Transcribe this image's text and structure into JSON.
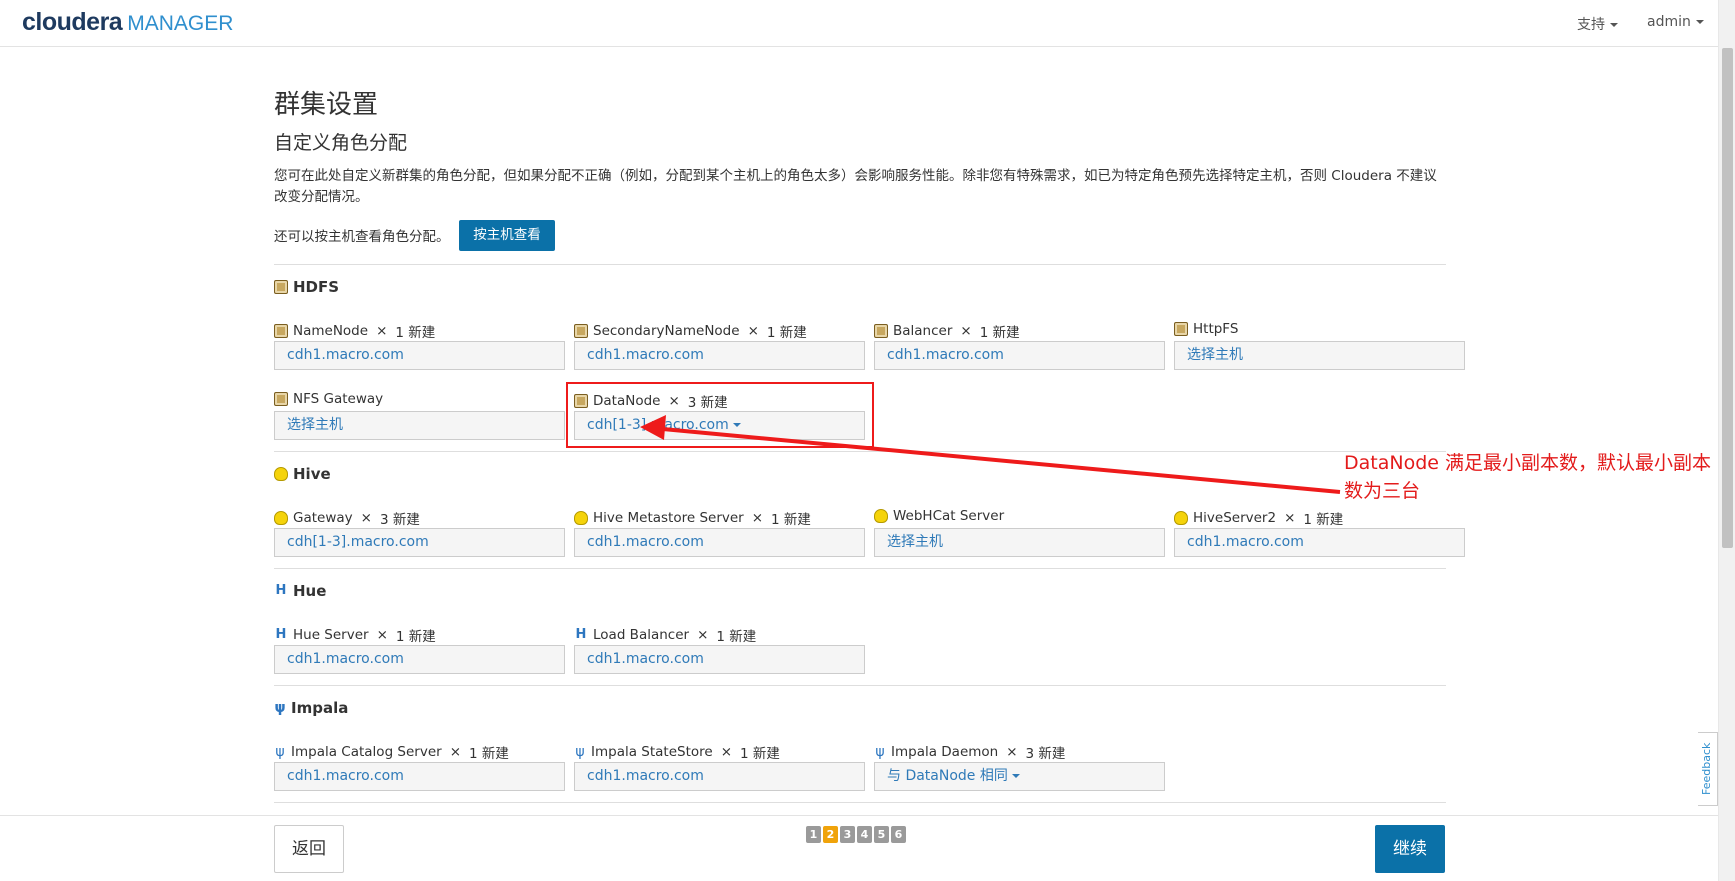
{
  "app": {
    "brand": "cloudera",
    "product": "MANAGER"
  },
  "topnav": {
    "support": "支持",
    "user": "admin"
  },
  "page": {
    "title": "群集设置",
    "subtitle": "自定义角色分配",
    "description": "您可在此处自定义新群集的角色分配，但如果分配不正确（例如，分配到某个主机上的角色太多）会影响服务性能。除非您有特殊需求，如已为特定角色预先选择特定主机，否则 Cloudera 不建议改变分配情况。",
    "byhost_text": "还可以按主机查看角色分配。",
    "byhost_button": "按主机查看"
  },
  "services": [
    {
      "name": "HDFS",
      "icon": "hdfs-icon",
      "roles": [
        {
          "name": "NameNode",
          "x": "×",
          "count": "1 新建",
          "value": "cdh1.macro.com"
        },
        {
          "name": "SecondaryNameNode",
          "x": "×",
          "count": "1 新建",
          "value": "cdh1.macro.com"
        },
        {
          "name": "Balancer",
          "x": "×",
          "count": "1 新建",
          "value": "cdh1.macro.com"
        },
        {
          "name": "HttpFS",
          "x": "",
          "count": "",
          "value": "选择主机"
        },
        {
          "name": "NFS Gateway",
          "x": "",
          "count": "",
          "value": "选择主机"
        },
        {
          "name": "DataNode",
          "x": "×",
          "count": "3 新建",
          "value": "cdh[1-3].macro.com"
        }
      ]
    },
    {
      "name": "Hive",
      "icon": "hive-icon",
      "roles": [
        {
          "name": "Gateway",
          "x": "×",
          "count": "3 新建",
          "value": "cdh[1-3].macro.com"
        },
        {
          "name": "Hive Metastore Server",
          "x": "×",
          "count": "1 新建",
          "value": "cdh1.macro.com"
        },
        {
          "name": "WebHCat Server",
          "x": "",
          "count": "",
          "value": "选择主机"
        },
        {
          "name": "HiveServer2",
          "x": "×",
          "count": "1 新建",
          "value": "cdh1.macro.com"
        }
      ]
    },
    {
      "name": "Hue",
      "icon": "hue-icon",
      "roles": [
        {
          "name": "Hue Server",
          "x": "×",
          "count": "1 新建",
          "value": "cdh1.macro.com"
        },
        {
          "name": "Load Balancer",
          "x": "×",
          "count": "1 新建",
          "value": "cdh1.macro.com"
        }
      ]
    },
    {
      "name": "Impala",
      "icon": "impala-icon",
      "roles": [
        {
          "name": "Impala Catalog Server",
          "x": "×",
          "count": "1 新建",
          "value": "cdh1.macro.com"
        },
        {
          "name": "Impala StateStore",
          "x": "×",
          "count": "1 新建",
          "value": "cdh1.macro.com"
        },
        {
          "name": "Impala Daemon",
          "x": "×",
          "count": "3 新建",
          "value": "与 DataNode 相同"
        }
      ]
    }
  ],
  "footer": {
    "back": "返回",
    "continue": "继续",
    "pages": [
      "1",
      "2",
      "3",
      "4",
      "5",
      "6"
    ],
    "active_page": "2"
  },
  "feedback": "Feedback",
  "annotation": "DataNode 满足最小副本数，默认最小副本数为三台",
  "colors": {
    "primary": "#0b71a8",
    "link": "#2f7ab8",
    "annotation": "#e31b1b",
    "active_page": "#f0a30a"
  }
}
